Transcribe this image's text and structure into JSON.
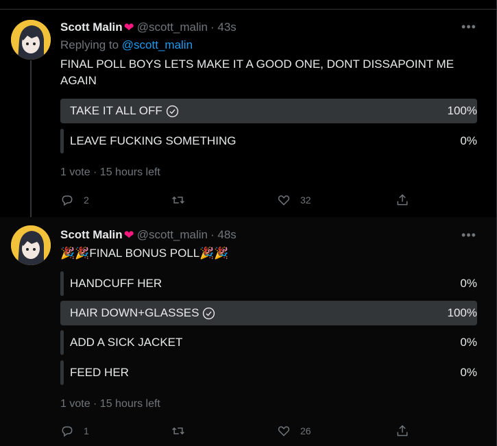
{
  "tweets": [
    {
      "author": {
        "name": "Scott Malin",
        "handle": "@scott_malin",
        "time": "· 43s"
      },
      "replying_label": "Replying to",
      "replying_handle": "@scott_malin",
      "text": "FINAL POLL BOYS LETS MAKE IT A GOOD ONE, DONT DISSAPOINT ME AGAIN",
      "poll": [
        {
          "label": "TAKE IT ALL OFF",
          "percent": "100%",
          "share": 100,
          "selected": true
        },
        {
          "label": "LEAVE FUCKING SOMETHING",
          "percent": "0%",
          "share": 0,
          "selected": false
        }
      ],
      "poll_meta": "1 vote · 15 hours left",
      "actions": {
        "replies": "2",
        "retweets": "",
        "likes": "32"
      }
    },
    {
      "author": {
        "name": "Scott Malin",
        "handle": "@scott_malin",
        "time": "· 48s"
      },
      "text": "🎉🎉FINAL BONUS POLL🎉🎉",
      "poll": [
        {
          "label": "HANDCUFF HER",
          "percent": "0%",
          "share": 0,
          "selected": false
        },
        {
          "label": "HAIR DOWN+GLASSES",
          "percent": "100%",
          "share": 100,
          "selected": true
        },
        {
          "label": "ADD A SICK JACKET",
          "percent": "0%",
          "share": 0,
          "selected": false
        },
        {
          "label": "FEED HER",
          "percent": "0%",
          "share": 0,
          "selected": false
        }
      ],
      "poll_meta": "1 vote · 15 hours left",
      "actions": {
        "replies": "1",
        "retweets": "",
        "likes": "26"
      }
    }
  ],
  "icons": {
    "heart_badge": "heart-emoji",
    "verified_check": "check-circle-icon",
    "more": "more-dots-icon",
    "reply": "reply-icon",
    "retweet": "retweet-icon",
    "like": "heart-icon",
    "share": "share-icon"
  },
  "colors": {
    "background": "#000000",
    "text": "#e7e9ea",
    "muted": "#71767b",
    "link": "#1d9bf0",
    "poll_bar": "#333639",
    "heart": "#f91880"
  }
}
